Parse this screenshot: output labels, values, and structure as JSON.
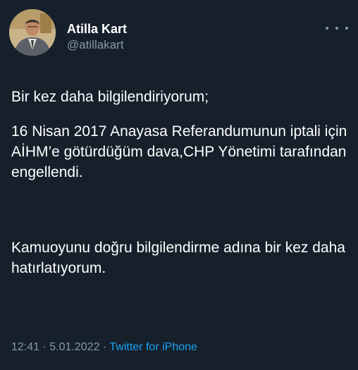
{
  "theme": {
    "background": "#15202b",
    "text_primary": "#ffffff",
    "text_secondary": "#8899a6",
    "link": "#1da1f2"
  },
  "tweet": {
    "author": {
      "display_name": "Atilla Kart",
      "handle": "@atillakart",
      "avatar_icon": "profile-photo"
    },
    "more_icon": "more-options-icon",
    "paragraphs": [
      "Bir kez daha bilgilendiriyorum;",
      "16 Nisan 2017 Anayasa Referandumunun iptali için AİHM’e götürdüğüm dava,CHP Yönetimi tarafından engellendi.",
      "Kamuoyunu doğru bilgilendirme adına bir kez daha hatırlatıyorum."
    ],
    "time": "12:41",
    "date": "5.01.2022",
    "separator": "·",
    "source": "Twitter for iPhone"
  }
}
